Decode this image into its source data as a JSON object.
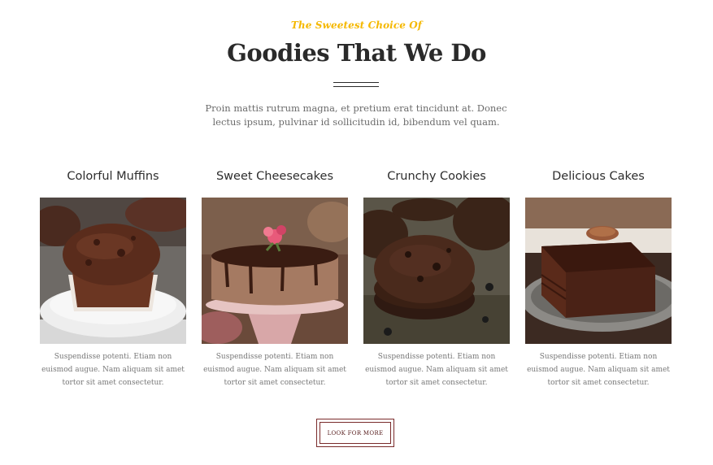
{
  "header": {
    "subtitle": "The Sweetest Choice Of",
    "title": "Goodies That We Do",
    "intro": "Proin mattis rutrum magna, et pretium erat tincidunt at. Donec lectus ipsum, pulvinar id sollicitudin id, bibendum vel quam."
  },
  "products": [
    {
      "title": "Colorful Muffins",
      "description": "Suspendisse potenti. Etiam non euismod augue. Nam aliquam sit amet tortor sit amet consectetur."
    },
    {
      "title": "Sweet Cheesecakes",
      "description": "Suspendisse potenti. Etiam non euismod augue. Nam aliquam sit amet tortor sit amet consectetur."
    },
    {
      "title": "Crunchy Cookies",
      "description": "Suspendisse potenti. Etiam non euismod augue. Nam aliquam sit amet tortor sit amet consectetur."
    },
    {
      "title": "Delicious Cakes",
      "description": "Suspendisse potenti. Etiam non euismod augue. Nam aliquam sit amet tortor sit amet consectetur."
    }
  ],
  "more_button": {
    "label": "LOOK FOR MORE"
  },
  "colors": {
    "accent": "#f5b800",
    "title": "#2a2a2a",
    "button_border": "#7a2b2b",
    "chocolate": "#4a2518"
  }
}
